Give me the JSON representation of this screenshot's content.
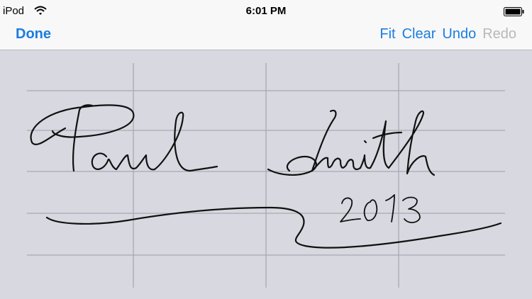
{
  "status_bar": {
    "device": "iPod",
    "time": "6:01 PM",
    "wifi_icon": "wifi-icon",
    "battery_icon": "battery-icon"
  },
  "toolbar": {
    "done_label": "Done",
    "fit_label": "Fit",
    "clear_label": "Clear",
    "undo_label": "Undo",
    "redo_label": "Redo"
  },
  "signature": {
    "name": "Paul Smith",
    "year": "2013"
  },
  "colors": {
    "accent": "#1a7de0",
    "disabled": "#b9b9bd",
    "canvas": "#d8d8e0",
    "grid": "#a9a9b3",
    "ink": "#111111"
  }
}
